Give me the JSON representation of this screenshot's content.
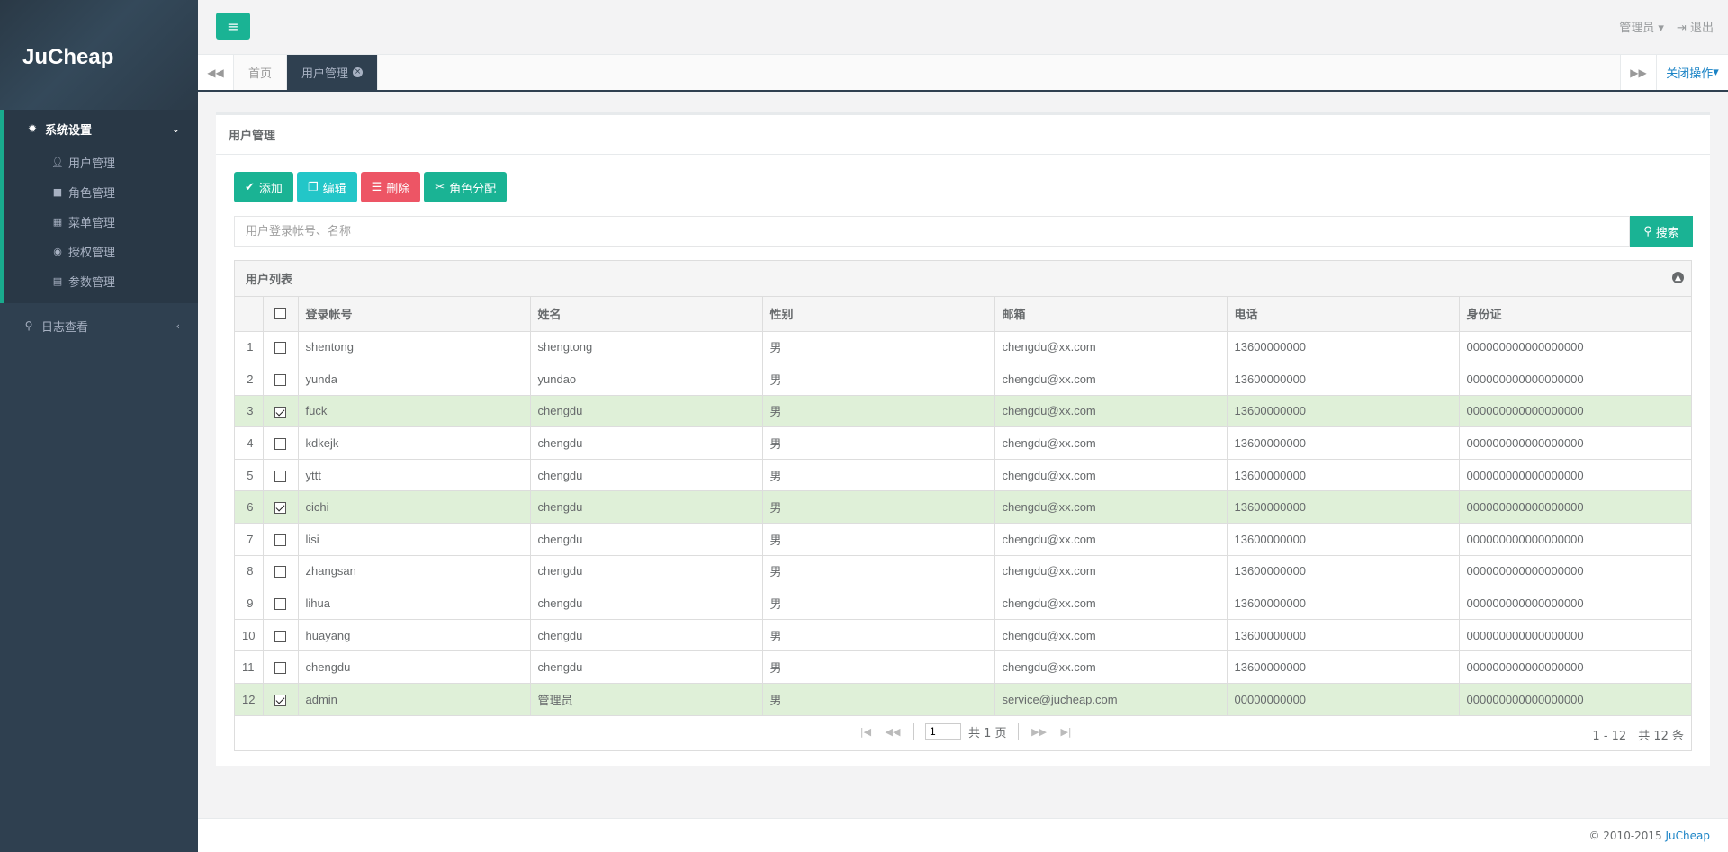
{
  "app": {
    "logo": "JuCheap"
  },
  "sidebar": {
    "groups": [
      {
        "label": "系统设置",
        "icon": "gear-icon",
        "items": [
          {
            "label": "用户管理",
            "icon": "user-icon"
          },
          {
            "label": "角色管理",
            "icon": "lock-icon"
          },
          {
            "label": "菜单管理",
            "icon": "grid-icon"
          },
          {
            "label": "授权管理",
            "icon": "eye-icon"
          },
          {
            "label": "参数管理",
            "icon": "document-icon"
          }
        ]
      },
      {
        "label": "日志查看",
        "icon": "search-icon"
      }
    ]
  },
  "topbar": {
    "user_label": "管理员",
    "logout_label": "退出"
  },
  "tabs": {
    "items": [
      "首页",
      "用户管理"
    ],
    "close_ops": "关闭操作"
  },
  "panel": {
    "title": "用户管理",
    "toolbar": {
      "add": "添加",
      "edit": "编辑",
      "delete": "删除",
      "role": "角色分配"
    },
    "search": {
      "placeholder": "用户登录帐号、名称",
      "button": "搜索"
    },
    "grid": {
      "caption": "用户列表",
      "columns": [
        "登录帐号",
        "姓名",
        "性别",
        "邮箱",
        "电话",
        "身份证"
      ],
      "rows": [
        {
          "n": "1",
          "checked": false,
          "cells": [
            "shentong",
            "shengtong",
            "男",
            "chengdu@xx.com",
            "13600000000",
            "000000000000000000"
          ]
        },
        {
          "n": "2",
          "checked": false,
          "cells": [
            "yunda",
            "yundao",
            "男",
            "chengdu@xx.com",
            "13600000000",
            "000000000000000000"
          ]
        },
        {
          "n": "3",
          "checked": true,
          "cells": [
            "fuck",
            "chengdu",
            "男",
            "chengdu@xx.com",
            "13600000000",
            "000000000000000000"
          ]
        },
        {
          "n": "4",
          "checked": false,
          "cells": [
            "kdkejk",
            "chengdu",
            "男",
            "chengdu@xx.com",
            "13600000000",
            "000000000000000000"
          ]
        },
        {
          "n": "5",
          "checked": false,
          "cells": [
            "yttt",
            "chengdu",
            "男",
            "chengdu@xx.com",
            "13600000000",
            "000000000000000000"
          ]
        },
        {
          "n": "6",
          "checked": true,
          "cells": [
            "cichi",
            "chengdu",
            "男",
            "chengdu@xx.com",
            "13600000000",
            "000000000000000000"
          ]
        },
        {
          "n": "7",
          "checked": false,
          "cells": [
            "lisi",
            "chengdu",
            "男",
            "chengdu@xx.com",
            "13600000000",
            "000000000000000000"
          ]
        },
        {
          "n": "8",
          "checked": false,
          "cells": [
            "zhangsan",
            "chengdu",
            "男",
            "chengdu@xx.com",
            "13600000000",
            "000000000000000000"
          ]
        },
        {
          "n": "9",
          "checked": false,
          "cells": [
            "lihua",
            "chengdu",
            "男",
            "chengdu@xx.com",
            "13600000000",
            "000000000000000000"
          ]
        },
        {
          "n": "10",
          "checked": false,
          "cells": [
            "huayang",
            "chengdu",
            "男",
            "chengdu@xx.com",
            "13600000000",
            "000000000000000000"
          ]
        },
        {
          "n": "11",
          "checked": false,
          "cells": [
            "chengdu",
            "chengdu",
            "男",
            "chengdu@xx.com",
            "13600000000",
            "000000000000000000"
          ]
        },
        {
          "n": "12",
          "checked": true,
          "cells": [
            "admin",
            "管理员",
            "男",
            "service@jucheap.com",
            "00000000000",
            "000000000000000000"
          ]
        }
      ],
      "pager": {
        "page": "1",
        "total_pages": "共 1 页",
        "summary": "1 - 12　共 12 条"
      }
    }
  },
  "footer": {
    "copyright": "© 2010-2015 ",
    "brand": "JuCheap"
  },
  "colors": {
    "primary": "#1ab394",
    "info": "#23c6c8",
    "danger": "#ed5565",
    "sidebar": "#2f4050",
    "selected_row": "#dff0d8"
  }
}
